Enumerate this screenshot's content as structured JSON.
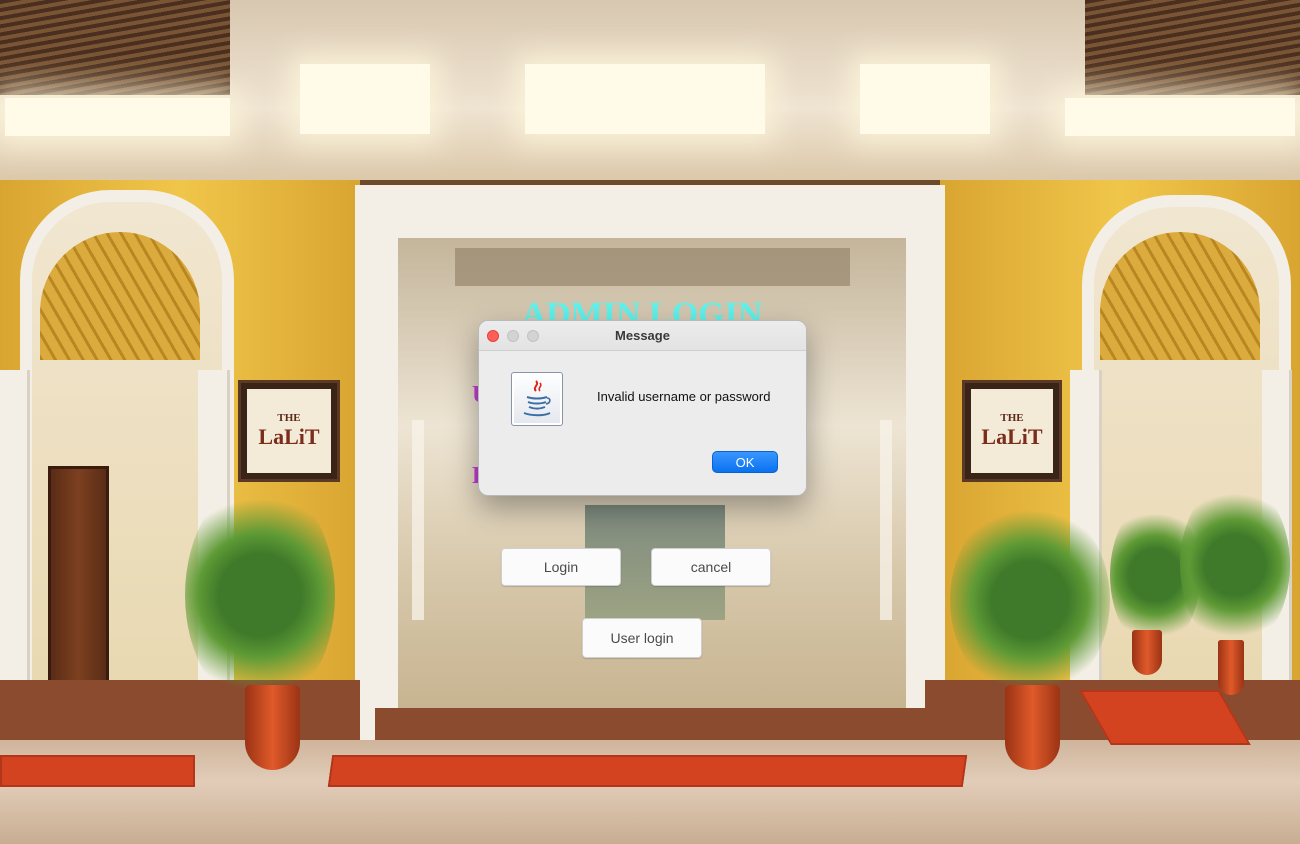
{
  "app": {
    "title": "ADMIN LOGIN",
    "field_labels": [
      "U",
      "P"
    ],
    "buttons": {
      "login": "Login",
      "cancel": "cancel",
      "user_login": "User login"
    }
  },
  "dialog": {
    "title": "Message",
    "message": "Invalid username or password",
    "ok_label": "OK",
    "icon": "java-icon"
  },
  "background": {
    "sign_text_top": "THE",
    "sign_text_brand": "LaLiT"
  },
  "colors": {
    "title": "#5ff2ec",
    "field_label": "#c13fd4",
    "ok_button": "#0a72f0",
    "close_light": "#ff5f57"
  }
}
